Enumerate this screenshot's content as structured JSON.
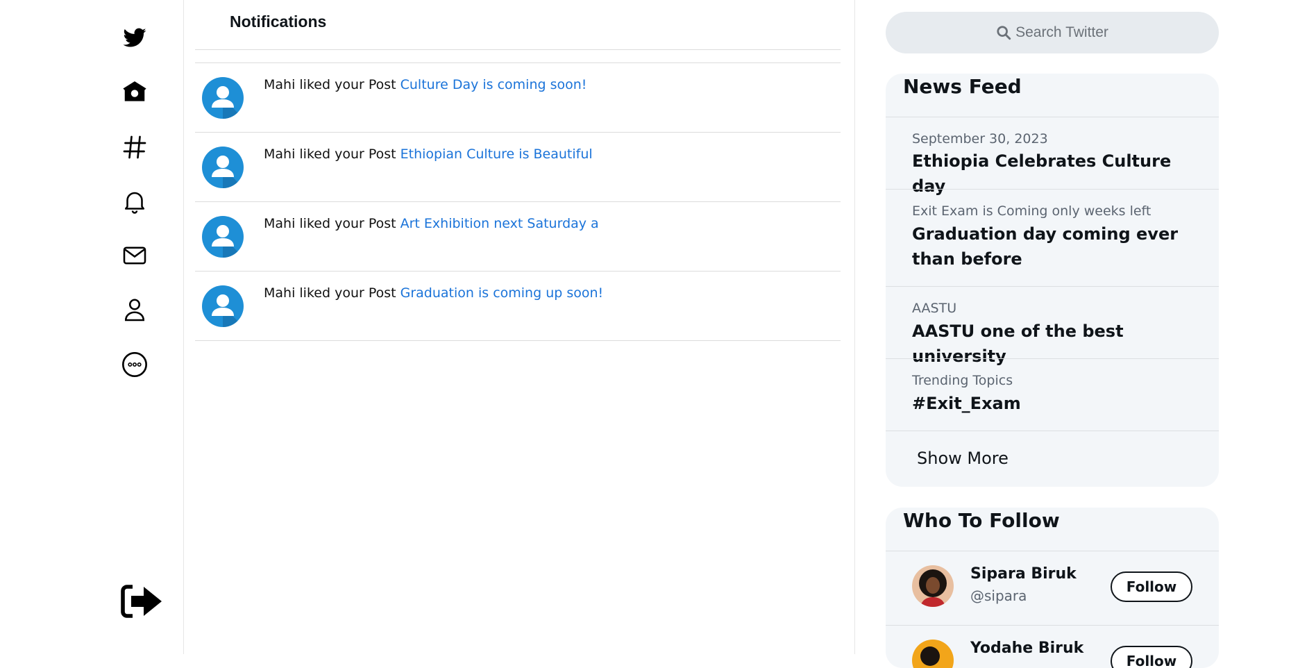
{
  "sidebar": {
    "items": [
      {
        "icon": "twitter-bird-icon"
      },
      {
        "icon": "home-icon"
      },
      {
        "icon": "hashtag-icon"
      },
      {
        "icon": "bell-icon"
      },
      {
        "icon": "mail-icon"
      },
      {
        "icon": "profile-icon"
      },
      {
        "icon": "more-icon"
      }
    ],
    "logout_icon": "logout-icon"
  },
  "main": {
    "title": "Notifications",
    "notifications": [
      {
        "prefix": "Mahi liked your Post ",
        "link": "Culture Day is coming soon!"
      },
      {
        "prefix": "Mahi liked your Post ",
        "link": "Ethiopian Culture is Beautiful"
      },
      {
        "prefix": "Mahi liked your Post ",
        "link": "Art Exhibition next Saturday a"
      },
      {
        "prefix": "Mahi liked your Post ",
        "link": "Graduation is coming up soon!"
      }
    ]
  },
  "search": {
    "placeholder": "Search Twitter"
  },
  "news_feed": {
    "title": "News Feed",
    "items": [
      {
        "sub": "September 30, 2023",
        "head": "Ethiopia Celebrates Culture day"
      },
      {
        "sub": "Exit Exam is Coming only weeks left",
        "head": "Graduation day coming ever than before"
      },
      {
        "sub": "AASTU",
        "head": "AASTU one of the best university"
      },
      {
        "sub": "Trending Topics",
        "head": "#Exit_Exam"
      }
    ],
    "show_more": "Show More"
  },
  "who_to_follow": {
    "title": "Who To Follow",
    "users": [
      {
        "name": "Sipara Biruk",
        "handle": "@sipara",
        "button": "Follow"
      },
      {
        "name": "Yodahe Biruk",
        "handle": "",
        "button": "Follow"
      }
    ]
  },
  "colors": {
    "accent": "#1a73d9",
    "avatar_blue": "#1e8fd6",
    "card_bg": "#f3f6f9"
  }
}
